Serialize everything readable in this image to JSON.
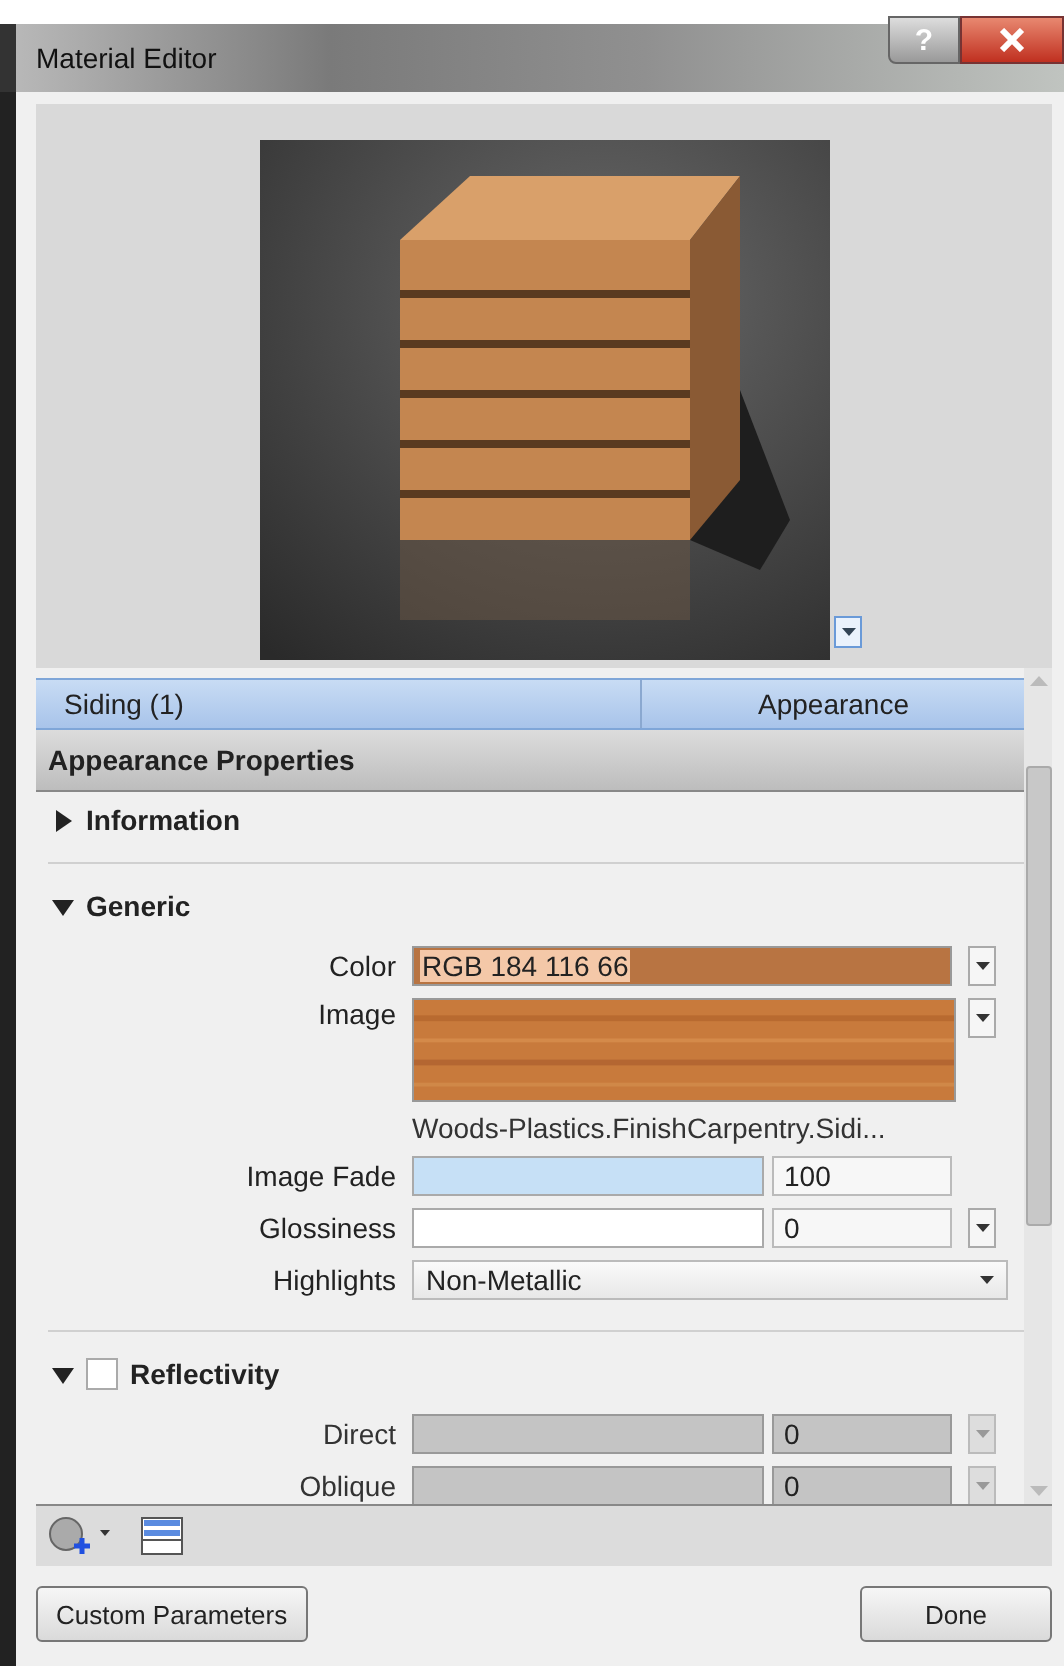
{
  "window": {
    "title": "Material Editor",
    "help": "?"
  },
  "header": {
    "material": "Siding (1)",
    "tab": "Appearance"
  },
  "panel_title": "Appearance Properties",
  "sections": [
    {
      "title": "Information",
      "expanded": false
    },
    {
      "title": "Generic",
      "expanded": true,
      "properties": [
        {
          "kind": "color",
          "label": "Color",
          "value": "RGB 184 116 66",
          "color": "#b87442"
        },
        {
          "label": "Image",
          "caption": "Woods-Plastics.FinishCarpentry.Sidi..."
        },
        {
          "kind": "slider",
          "label": "Image Fade",
          "level": 1,
          "value": "100",
          "menu": false,
          "disabled": false
        },
        {
          "kind": "slider",
          "label": "Glossiness",
          "level": 0,
          "value": "0",
          "menu": true,
          "disabled": false
        },
        {
          "kind": "select",
          "label": "Highlights",
          "value": "Non-Metallic"
        }
      ]
    },
    {
      "title": "Reflectivity",
      "expanded": true,
      "checked": false,
      "properties": [
        {
          "kind": "slider",
          "label": "Direct",
          "level": 0,
          "value": "0",
          "menu": true,
          "disabled": true
        },
        {
          "kind": "slider",
          "label": "Oblique",
          "level": 0,
          "value": "0",
          "menu": true,
          "disabled": true
        }
      ]
    }
  ],
  "buttons": [
    "Custom Parameters",
    "Done"
  ]
}
